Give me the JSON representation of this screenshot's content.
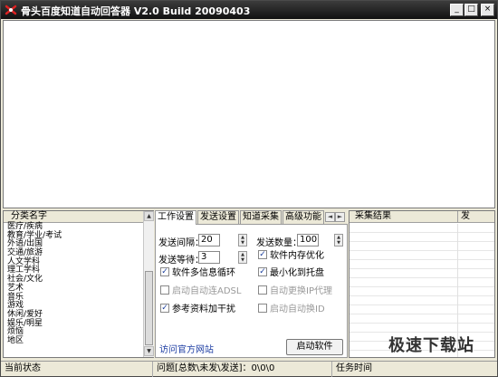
{
  "window": {
    "title": "骨头百度知道自动回答器 V2.0 Build 20090403",
    "minimize_glyph": "_",
    "maximize_glyph": "□",
    "close_glyph": "×"
  },
  "categories": {
    "header": "分类名字",
    "items": [
      "医疗/疾病",
      "教育/学业/考试",
      "外语/出国",
      "交通/旅游",
      "人文学科",
      "理工学科",
      "社会/文化",
      "艺术",
      "音乐",
      "游戏",
      "休闲/爱好",
      "娱乐/明星",
      "烦恼",
      "地区"
    ]
  },
  "tabs": {
    "items": [
      "工作设置",
      "发送设置",
      "知道采集",
      "高级功能"
    ],
    "active": "工作设置",
    "left_arrow": "◄",
    "right_arrow": "►"
  },
  "settings": {
    "send_interval_label": "发送间隔：",
    "send_interval_value": "20",
    "send_count_label": "发送数量：",
    "send_count_value": "100",
    "send_wait_label": "发送等待：",
    "send_wait_value": "3",
    "checkboxes": [
      {
        "label": "软件内存优化",
        "checked": true,
        "enabled": true
      },
      {
        "label": "软件多信息循环",
        "checked": true,
        "enabled": true
      },
      {
        "label": "最小化到托盘",
        "checked": true,
        "enabled": true
      },
      {
        "label": "启动自动连ADSL",
        "checked": false,
        "enabled": false
      },
      {
        "label": "自动更换IP代理",
        "checked": false,
        "enabled": false
      },
      {
        "label": "参考资料加干扰",
        "checked": true,
        "enabled": true
      },
      {
        "label": "启动自动换ID",
        "checked": false,
        "enabled": false
      }
    ],
    "visit_site_link": "访问官方网站",
    "start_button": "启动软件"
  },
  "results": {
    "col1": "采集结果",
    "col2": "发"
  },
  "watermark": "极速下载站",
  "statusbar": {
    "current_status": "当前状态",
    "question_stats": "问题[总数\\未发\\发送]：0\\0\\0",
    "task_time": "任务时间"
  },
  "colors": {
    "titlebar": "#1a1a1a",
    "link": "#1e3ea3",
    "check": "#1a3e9c"
  }
}
